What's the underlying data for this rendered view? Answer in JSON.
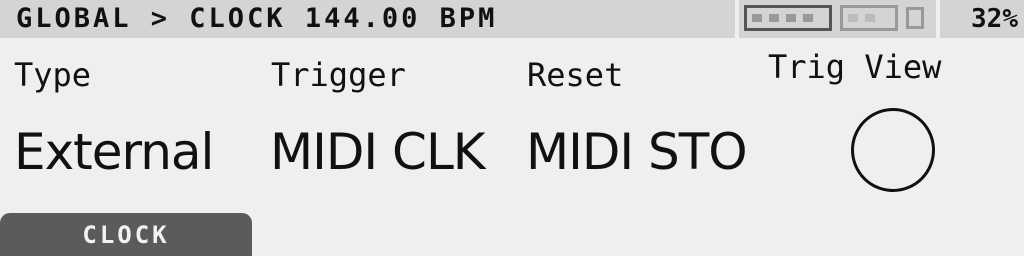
{
  "header": {
    "breadcrumb": "GLOBAL > CLOCK 144.00 BPM",
    "battery_icon": "battery-icon",
    "battery_percent": "32%"
  },
  "params": [
    {
      "label": "Type",
      "value": "External"
    },
    {
      "label": "Trigger",
      "value": "MIDI CLK"
    },
    {
      "label": "Reset",
      "value": "MIDI STO"
    }
  ],
  "trig_view": {
    "label": "Trig View",
    "indicator_icon": "trig-indicator-circle"
  },
  "tab": {
    "label": "CLOCK"
  },
  "colors": {
    "background": "#efefef",
    "header": "#d4d4d4",
    "text": "#111111",
    "tab": "#5b5b5b",
    "tab_text": "#f2f2f2"
  }
}
